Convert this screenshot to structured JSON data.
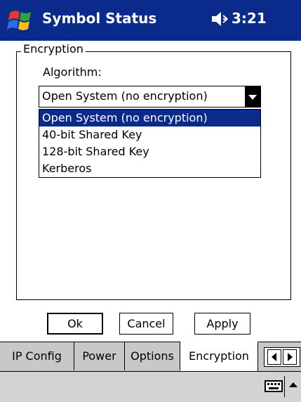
{
  "titlebar": {
    "title": "Symbol Status",
    "time": "3:21",
    "icons": {
      "start": "windows-flag-icon",
      "volume": "speaker-icon"
    },
    "bg_color": "#0a2a8c"
  },
  "encryption": {
    "group_label": "Encryption",
    "algorithm_label": "Algorithm:",
    "selected_value": "Open System (no encryption)",
    "options": [
      "Open System (no encryption)",
      "40-bit Shared Key",
      "128-bit Shared Key",
      "Kerberos"
    ]
  },
  "buttons": {
    "ok": "Ok",
    "cancel": "Cancel",
    "apply": "Apply"
  },
  "tabs": [
    {
      "label": "IP Config",
      "active": false
    },
    {
      "label": "Power",
      "active": false
    },
    {
      "label": "Options",
      "active": false
    },
    {
      "label": "Encryption",
      "active": true
    }
  ],
  "menubar": {
    "icons": {
      "keyboard": "keyboard-icon",
      "sip": "sip-up-arrow-icon"
    }
  }
}
